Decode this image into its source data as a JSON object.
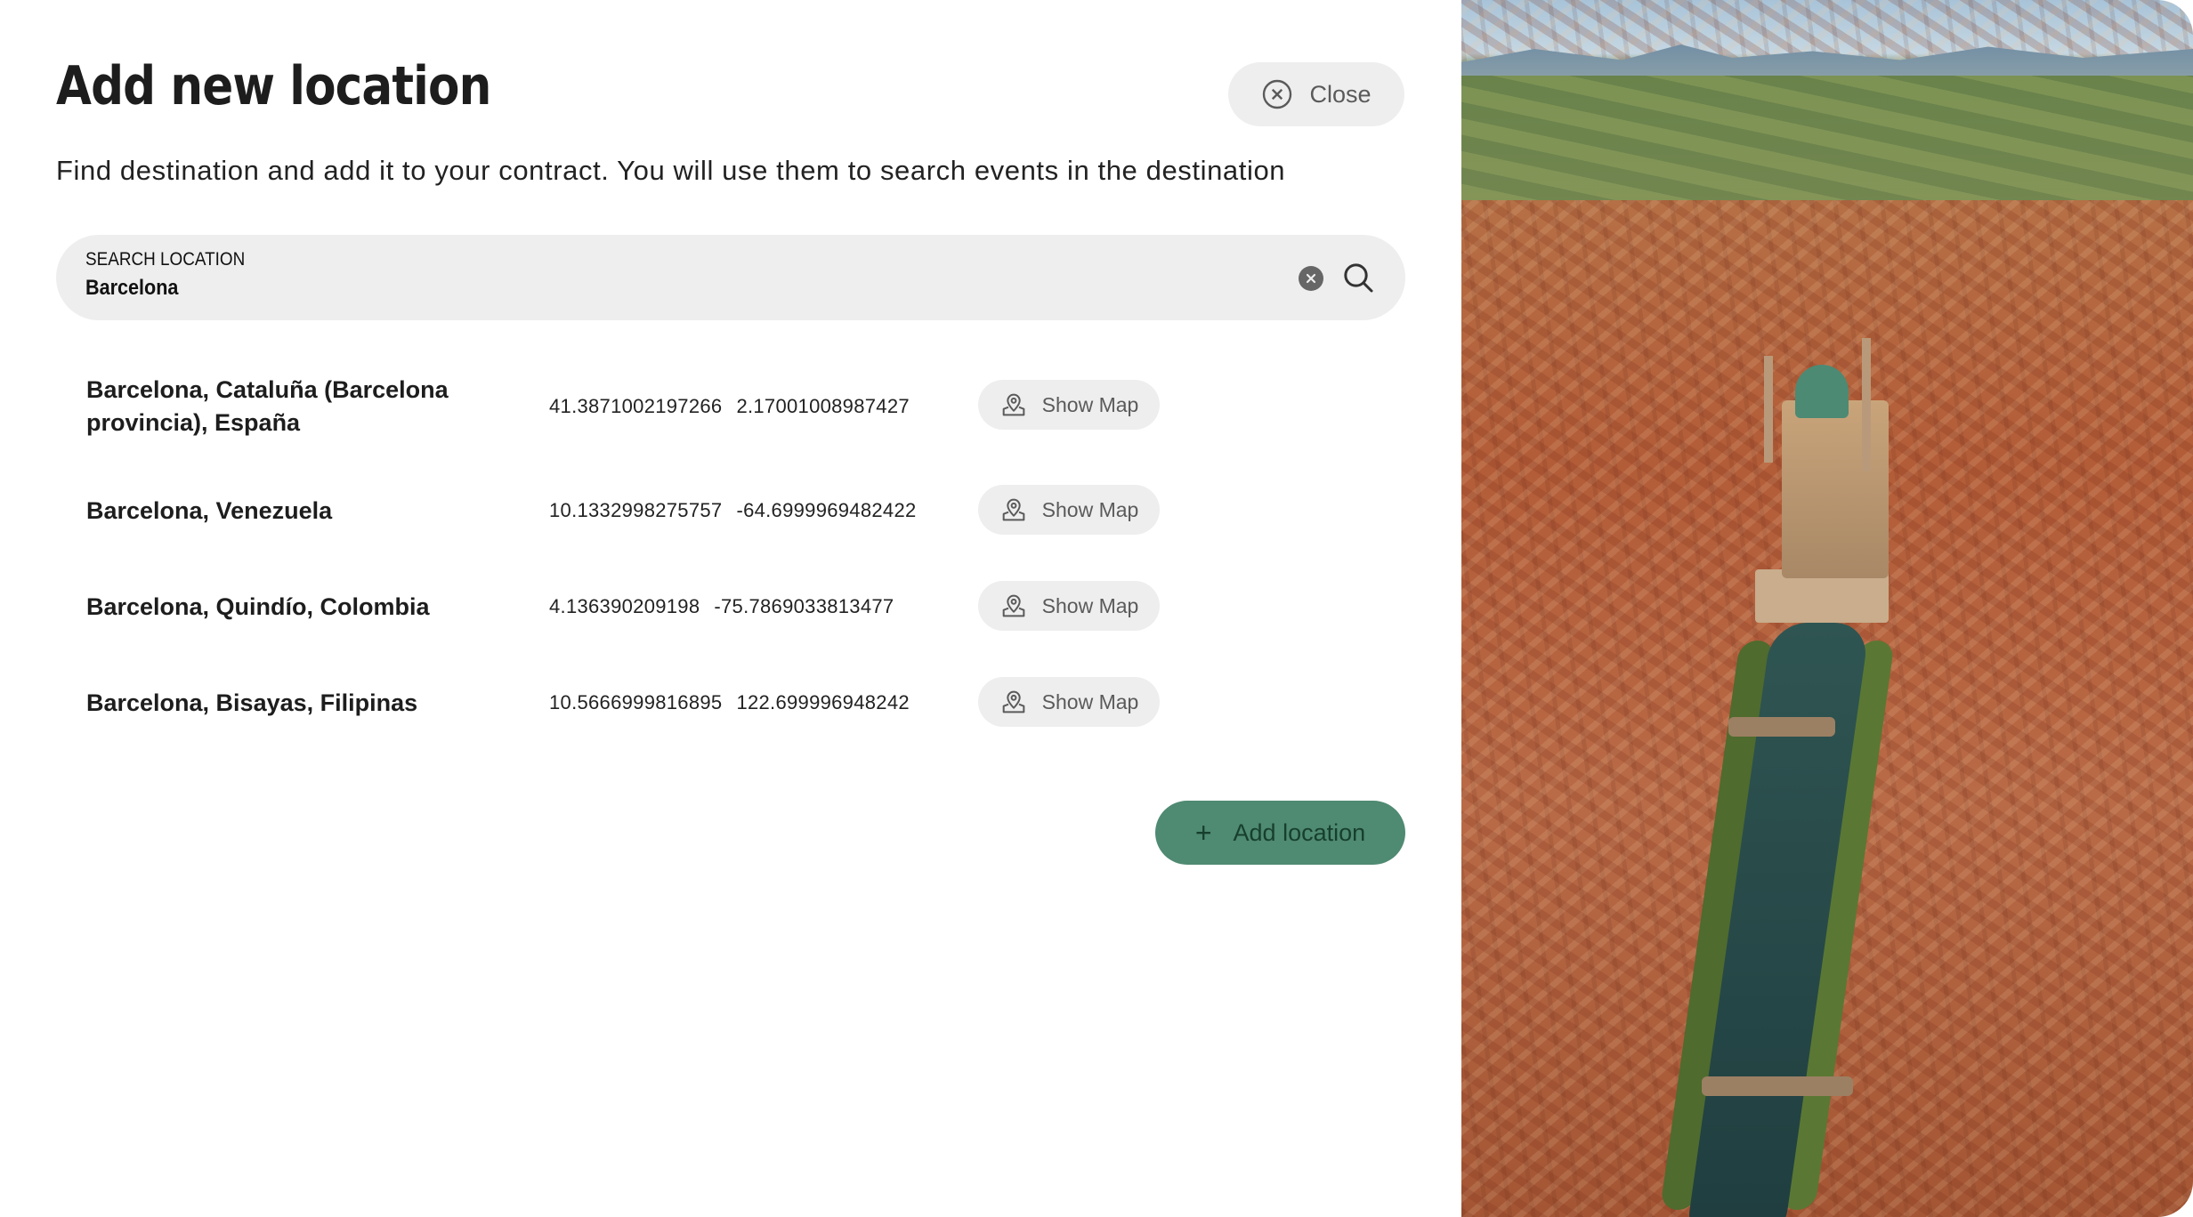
{
  "dialog": {
    "title": "Add new location",
    "subtitle": "Find destination and add it to your contract. You will use them to search events in the destination",
    "close_label": "Close"
  },
  "search": {
    "label": "SEARCH LOCATION",
    "value": "Barcelona"
  },
  "results": [
    {
      "name": "Barcelona, Cataluña (Barcelona provincia), España",
      "lat": "41.3871002197266",
      "lng": "2.17001008987427",
      "map_label": "Show Map"
    },
    {
      "name": "Barcelona, Venezuela",
      "lat": "10.1332998275757",
      "lng": "-64.6999969482422",
      "map_label": "Show Map"
    },
    {
      "name": "Barcelona, Quindío, Colombia",
      "lat": "4.136390209198",
      "lng": "-75.7869033813477",
      "map_label": "Show Map"
    },
    {
      "name": "Barcelona, Bisayas, Filipinas",
      "lat": "10.5666999816895",
      "lng": "122.699996948242",
      "map_label": "Show Map"
    }
  ],
  "add_button": {
    "label": "Add location",
    "icon": "plus-icon"
  },
  "colors": {
    "accent": "#4f8a72",
    "button_bg": "#eeeeee",
    "text": "#1d1d1d"
  },
  "icons": {
    "close": "close-circle-icon",
    "search": "search-icon",
    "clear": "clear-icon",
    "map": "map-pin-icon"
  }
}
